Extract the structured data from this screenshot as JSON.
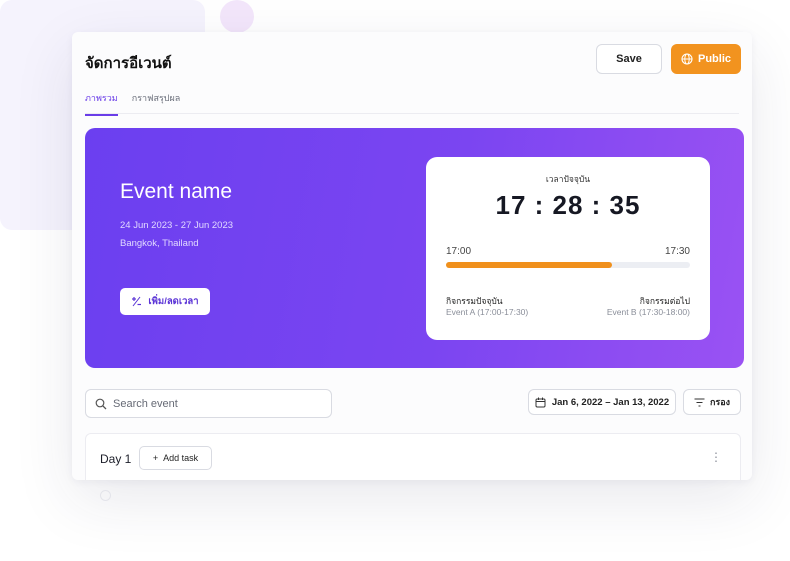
{
  "header": {
    "title": "จัดการอีเวนต์",
    "save_label": "Save",
    "public_label": "Public"
  },
  "tabs": [
    {
      "label": "ภาพรวม",
      "active": true
    },
    {
      "label": "กราฟสรุปผล",
      "active": false
    }
  ],
  "hero": {
    "event_name": "Event name",
    "dates": "24 Jun 2023 - 27 Jun 2023",
    "location": "Bangkok, Thailand",
    "adjust_time_label": "เพิ่ม/ลดเวลา"
  },
  "clock": {
    "label": "เวลาปัจจุบัน",
    "time": "17 : 28 : 35",
    "range_start": "17:00",
    "range_end": "17:30",
    "progress_fraction": 0.68,
    "current_activity_title": "กิจกรรมปัจจุบัน",
    "current_activity": "Event A (17:00-17:30)",
    "next_activity_title": "กิจกรรมต่อไป",
    "next_activity": "Event B (17:30-18:00)"
  },
  "toolbar": {
    "search_placeholder": "Search event",
    "date_range": "Jan 6, 2022 – Jan 13, 2022",
    "filter_label": "กรอง"
  },
  "day": {
    "label": "Day 1",
    "add_task_label": "Add task"
  },
  "colors": {
    "accent_purple": "#6b3ff0",
    "accent_orange": "#f2931f"
  },
  "icons": [
    "globe-icon",
    "plus-minus-icon",
    "search-icon",
    "calendar-icon",
    "filter-icon",
    "plus-icon",
    "kebab-icon"
  ]
}
